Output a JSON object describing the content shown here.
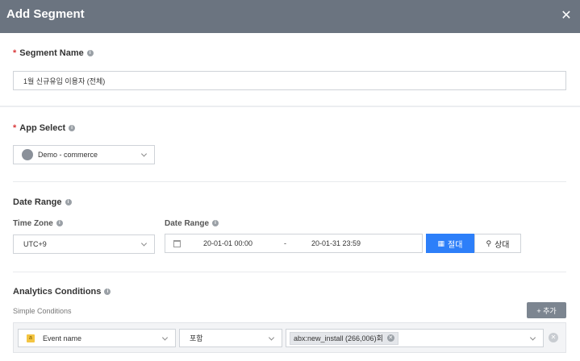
{
  "header": {
    "title": "Add Segment",
    "close_glyph": "✕"
  },
  "segment_name": {
    "required_mark": "*",
    "label": "Segment Name",
    "value": "1월 신규유입 이용자 (전체)"
  },
  "app_select": {
    "required_mark": "*",
    "label": "App Select",
    "selected": "Demo - commerce"
  },
  "date_range": {
    "section_label": "Date Range",
    "time_zone_label": "Time Zone",
    "time_zone_value": "UTC+9",
    "date_range_label": "Date Range",
    "start": "20-01-01 00:00",
    "separator": "-",
    "end": "20-01-31 23:59",
    "absolute_label": "절대",
    "relative_label": "상대",
    "absolute_icon": "▦",
    "relative_icon": "⚲"
  },
  "analytics": {
    "section_label": "Analytics Conditions",
    "simple_label": "Simple Conditions",
    "add_label": "+ 추가",
    "condition": {
      "badge": "a",
      "event_field": "Event name",
      "operator": "포함",
      "tag_value": "abx:new_install (266,006)회",
      "tag_remove": "✕",
      "row_remove": "✕"
    }
  },
  "colors": {
    "header_bg": "#6b7480",
    "primary": "#2d7ff9",
    "required": "#d9383a",
    "badge": "#f4c542"
  }
}
